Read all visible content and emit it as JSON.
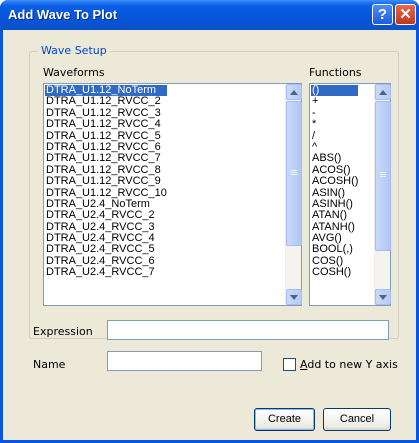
{
  "window": {
    "title": "Add Wave To Plot",
    "help_glyph": "?",
    "close_glyph": "✕"
  },
  "wave_setup": {
    "group_title": "Wave Setup",
    "waveforms_label": "Waveforms",
    "functions_label": "Functions",
    "waveforms": [
      "DTRA_U1.12_NoTerm",
      "DTRA_U1.12_RVCC_2",
      "DTRA_U1.12_RVCC_3",
      "DTRA_U1.12_RVCC_4",
      "DTRA_U1.12_RVCC_5",
      "DTRA_U1.12_RVCC_6",
      "DTRA_U1.12_RVCC_7",
      "DTRA_U1.12_RVCC_8",
      "DTRA_U1.12_RVCC_9",
      "DTRA_U1.12_RVCC_10",
      "DTRA_U2.4_NoTerm",
      "DTRA_U2.4_RVCC_2",
      "DTRA_U2.4_RVCC_3",
      "DTRA_U2.4_RVCC_4",
      "DTRA_U2.4_RVCC_5",
      "DTRA_U2.4_RVCC_6",
      "DTRA_U2.4_RVCC_7"
    ],
    "selected_waveform": "DTRA_U1.12_NoTerm",
    "functions": [
      "()",
      "+",
      "-",
      "*",
      "/",
      "^",
      "ABS()",
      "ACOS()",
      "ACOSH()",
      "ASIN()",
      "ASINH()",
      "ATAN()",
      "ATANH()",
      "AVG()",
      "BOOL(,)",
      "COS()",
      "COSH()"
    ],
    "selected_function": "()"
  },
  "form": {
    "expression_label": "Expression",
    "expression_value": "",
    "name_label": "Name",
    "name_value": "",
    "add_to_new_y_axis_prefix": "A",
    "add_to_new_y_axis_rest": "dd to new Y axis",
    "add_to_new_y_axis_checked": false
  },
  "buttons": {
    "create": "Create",
    "cancel": "Cancel"
  },
  "colors": {
    "titlebar": "#0654d8",
    "selection": "#316ac5",
    "group_title": "#0046d5",
    "dialog_bg": "#ece9d8"
  }
}
